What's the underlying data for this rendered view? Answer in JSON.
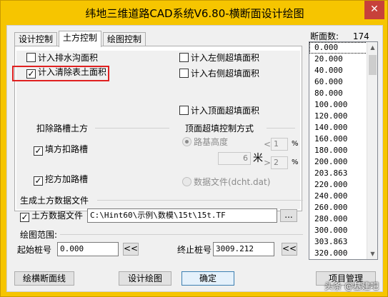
{
  "window": {
    "title": "纬地三维道路CAD系统V6.80-横断面设计绘图",
    "close_glyph": "✕"
  },
  "tabs": [
    {
      "label": "设计控制",
      "active": false
    },
    {
      "label": "土方控制",
      "active": true
    },
    {
      "label": "绘图控制",
      "active": false
    }
  ],
  "earthwork": {
    "checkboxes": {
      "drainage_area": {
        "label": "计入排水沟面积",
        "checked": false
      },
      "clear_surface": {
        "label": "计入清除表土面积",
        "checked": true
      },
      "left_overfill": {
        "label": "计入左侧超填面积",
        "checked": false
      },
      "right_overfill": {
        "label": "计入右侧超填面积",
        "checked": false
      },
      "top_overfill": {
        "label": "计入顶面超填面积",
        "checked": false
      }
    },
    "trench_group": {
      "title": "扣除路槽土方",
      "fill_deduct": {
        "label": "填方扣路槽",
        "checked": true
      },
      "cut_add": {
        "label": "挖方加路槽",
        "checked": true
      }
    },
    "top_overfill_group": {
      "title": "顶面超填控制方式",
      "roadbed_height_label": "路基高度",
      "height_value": "6",
      "meter_unit": "米",
      "lt_symbol": "<",
      "gt_symbol": ">",
      "pct_1": "1",
      "pct_2": "2",
      "percent": "%",
      "data_file_label": "数据文件(dcht.dat)"
    }
  },
  "generate": {
    "section_title": "生成土方数据文件",
    "file_checkbox": {
      "label": "土方数据文件",
      "checked": true
    },
    "file_path": "C:\\Hint60\\示例\\数模\\15t\\15t.TF",
    "browse_label": "..."
  },
  "range": {
    "section_title": "绘图范围:",
    "start_label": "起始桩号",
    "start_value": "0.000",
    "end_label": "终止桩号",
    "end_value": "3009.212",
    "pick_label": "<<"
  },
  "stations": {
    "label": "断面数:",
    "count": "174",
    "items": [
      "0.000",
      "20.000",
      "40.000",
      "60.000",
      "80.000",
      "100.000",
      "120.000",
      "140.000",
      "160.000",
      "180.000",
      "200.000",
      "203.863",
      "220.000",
      "240.000",
      "260.000",
      "280.000",
      "300.000",
      "303.863",
      "320.000"
    ]
  },
  "buttons": {
    "draw_sections": "绘横断面线",
    "design_draw": "设计绘图",
    "ok": "确定",
    "project": "项目管理"
  },
  "watermark": "头条 @基建吧"
}
